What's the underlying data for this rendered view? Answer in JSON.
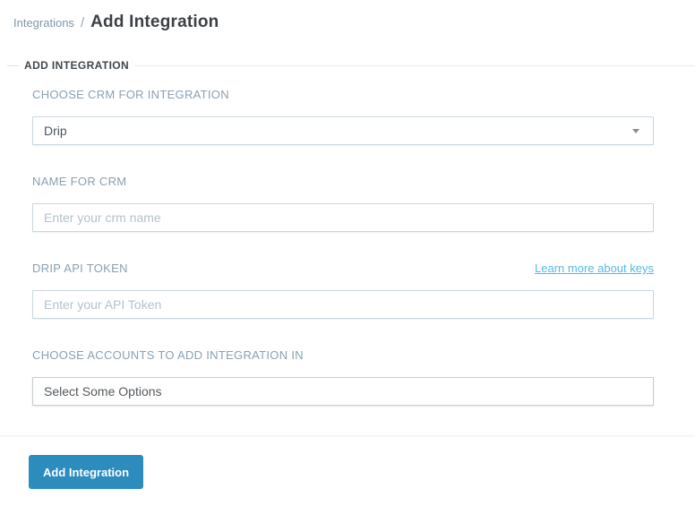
{
  "breadcrumb": {
    "parent": "Integrations",
    "separator": "/",
    "current": "Add Integration"
  },
  "section": {
    "legend": "ADD INTEGRATION"
  },
  "form": {
    "crm_select": {
      "label": "CHOOSE CRM FOR INTEGRATION",
      "value": "Drip"
    },
    "crm_name": {
      "label": "NAME FOR CRM",
      "placeholder": "Enter your crm name",
      "value": ""
    },
    "api_token": {
      "label": "DRIP API TOKEN",
      "link_label": "Learn more about keys",
      "placeholder": "Enter your API Token",
      "value": ""
    },
    "accounts": {
      "label": "CHOOSE ACCOUNTS TO ADD INTEGRATION IN",
      "value": "Select Some Options"
    }
  },
  "actions": {
    "submit_label": "Add Integration"
  },
  "icons": {
    "dropdown_caret": "caret-down"
  },
  "colors": {
    "accent": "#2b8cbd",
    "link": "#58b7e8",
    "label": "#8aa1b2",
    "input_border": "#c9d8df",
    "placeholder": "#b3c2cc",
    "title": "#3b4146",
    "breadcrumb_link": "#7e98a8"
  }
}
